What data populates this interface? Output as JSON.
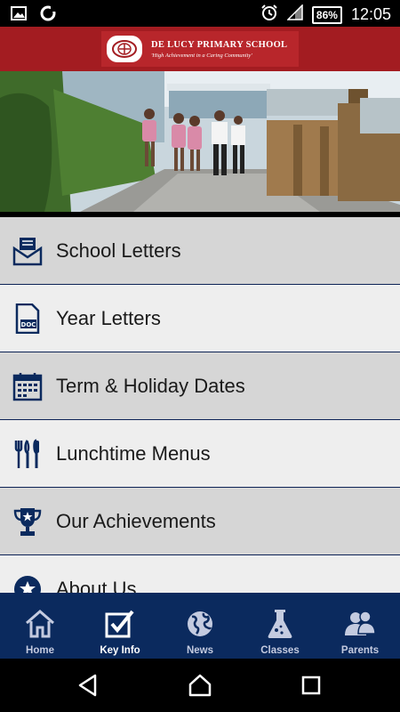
{
  "status_bar": {
    "battery": "86%",
    "time": "12:05",
    "icons": [
      "image-icon",
      "sync-icon",
      "alarm-icon",
      "signal-icon",
      "battery-icon"
    ]
  },
  "header": {
    "school_name": "DE LUCY PRIMARY SCHOOL",
    "motto": "'High Achievement in a Caring Community'",
    "brand_color": "#a31c21"
  },
  "menu": {
    "items": [
      {
        "label": "School Letters",
        "icon": "envelope-icon"
      },
      {
        "label": "Year Letters",
        "icon": "doc-icon"
      },
      {
        "label": "Term & Holiday Dates",
        "icon": "calendar-icon"
      },
      {
        "label": "Lunchtime Menus",
        "icon": "cutlery-icon"
      },
      {
        "label": "Our Achievements",
        "icon": "trophy-icon"
      },
      {
        "label": "About Us",
        "icon": "star-icon"
      }
    ]
  },
  "tab_bar": {
    "color": "#0b2a5e",
    "tabs": [
      {
        "label": "Home",
        "icon": "home-icon"
      },
      {
        "label": "Key Info",
        "icon": "checkbox-icon",
        "active": true
      },
      {
        "label": "News",
        "icon": "globe-icon"
      },
      {
        "label": "Classes",
        "icon": "flask-icon"
      },
      {
        "label": "Parents",
        "icon": "people-icon"
      }
    ]
  },
  "nav_bar": {
    "buttons": [
      "back-icon",
      "home-nav-icon",
      "recents-icon"
    ]
  }
}
